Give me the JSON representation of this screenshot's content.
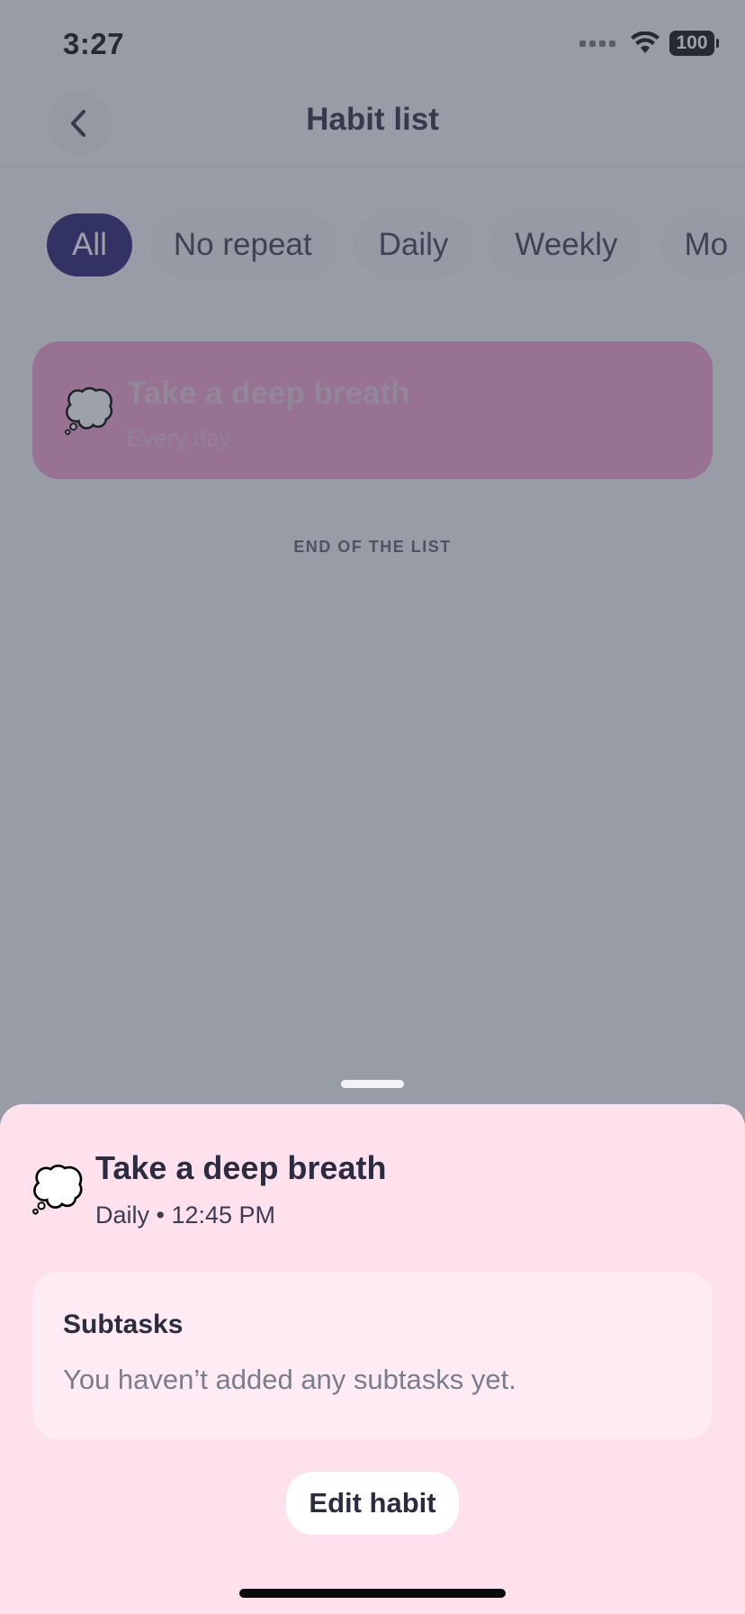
{
  "status_bar": {
    "time": "3:27",
    "battery": "100"
  },
  "header": {
    "title": "Habit list",
    "back_icon": "chevron-left-icon"
  },
  "filters": [
    {
      "label": "All",
      "active": true
    },
    {
      "label": "No repeat",
      "active": false
    },
    {
      "label": "Daily",
      "active": false
    },
    {
      "label": "Weekly",
      "active": false
    },
    {
      "label": "Mo",
      "active": false
    }
  ],
  "habits": [
    {
      "emoji": "💭",
      "title": "Take a deep breath",
      "subtitle": "Every day",
      "color": "#f3a1d1"
    }
  ],
  "list_end_label": "END OF THE LIST",
  "sheet": {
    "emoji": "💭",
    "title": "Take a deep breath",
    "subtitle": "Daily • 12:45 PM",
    "subtasks_title": "Subtasks",
    "subtasks_empty": "You haven’t added any subtasks yet.",
    "edit_label": "Edit habit",
    "background": "#ffe1ee"
  },
  "colors": {
    "accent": "#2b2177",
    "overlay": "#3c4454"
  }
}
